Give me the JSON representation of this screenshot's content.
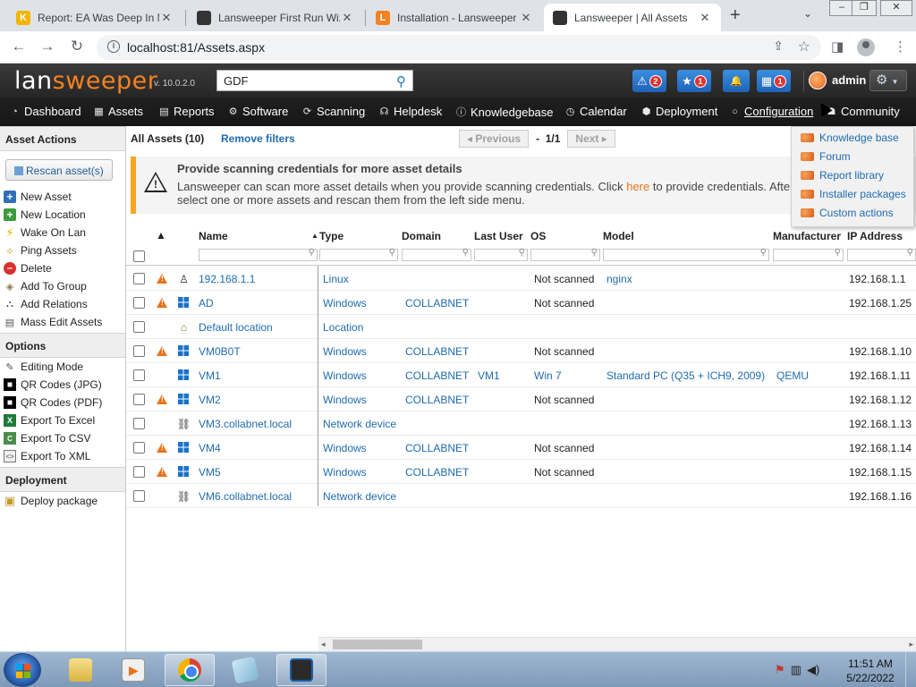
{
  "browser": {
    "tabs": [
      {
        "title": "Report: EA Was Deep In M",
        "favicon_color": "#f4b400",
        "favicon_glyph": "K",
        "active": false
      },
      {
        "title": "Lansweeper First Run Wiz",
        "favicon_color": "#333333",
        "favicon_glyph": "",
        "active": false
      },
      {
        "title": "Installation - Lansweeper",
        "favicon_color": "#f58220",
        "favicon_glyph": "L",
        "active": false
      },
      {
        "title": "Lansweeper | All Assets",
        "favicon_color": "#333333",
        "favicon_glyph": "",
        "active": true
      }
    ],
    "new_tab": "+",
    "tab_menu": "⌄",
    "window_controls": [
      "–",
      "❐",
      "✕"
    ],
    "url": "localhost:81/Assets.aspx",
    "icons": {
      "back": "back-icon",
      "forward": "forward-icon",
      "reload": "reload-icon",
      "info": "info-icon",
      "share": "share-icon",
      "star": "bookmark-star-icon",
      "sidepanel": "side-panel-icon",
      "profile": "profile-icon",
      "menu": "kebab-menu-icon"
    }
  },
  "header": {
    "logo_part1": "lan",
    "logo_part2": "sweeper",
    "version": "v. 10.0.2.0",
    "search_value": "GDF",
    "buttons": [
      {
        "name": "alerts-button",
        "icon": "⚠",
        "count": "2"
      },
      {
        "name": "favorites-button",
        "icon": "★",
        "count": "1"
      },
      {
        "name": "notifications-button",
        "icon": "🔔",
        "count": ""
      },
      {
        "name": "calendar-button",
        "icon": "▦",
        "count": "1"
      }
    ],
    "user": "admin",
    "settings_icon": "⚙",
    "brand_orange": "#f58220"
  },
  "nav": [
    {
      "label": "Dashboard",
      "icon": "dashboard-icon",
      "glyph": "◔"
    },
    {
      "label": "Assets",
      "icon": "assets-icon",
      "glyph": "▦"
    },
    {
      "label": "Reports",
      "icon": "reports-icon",
      "glyph": "▤"
    },
    {
      "label": "Software",
      "icon": "software-icon",
      "glyph": "⚙"
    },
    {
      "label": "Scanning",
      "icon": "scanning-icon",
      "glyph": "⟳"
    },
    {
      "label": "Helpdesk",
      "icon": "helpdesk-icon",
      "glyph": "☊"
    },
    {
      "label": "Knowledgebase",
      "icon": "knowledgebase-icon",
      "glyph": "ⓘ"
    },
    {
      "label": "Calendar",
      "icon": "calendar-icon",
      "glyph": "◷"
    },
    {
      "label": "Deployment",
      "icon": "deployment-icon",
      "glyph": "⬢"
    },
    {
      "label": "Configuration",
      "icon": "configuration-icon",
      "glyph": "○"
    },
    {
      "label": "Community",
      "icon": "community-icon",
      "glyph": "☗"
    }
  ],
  "sidebar": {
    "asset_actions_title": "Asset Actions",
    "rescan_label": "Rescan asset(s)",
    "actions": [
      {
        "label": "New Asset",
        "icon": "new-asset-icon"
      },
      {
        "label": "New Location",
        "icon": "new-location-icon"
      },
      {
        "label": "Wake On Lan",
        "icon": "wake-on-lan-icon"
      },
      {
        "label": "Ping Assets",
        "icon": "ping-icon"
      },
      {
        "label": "Delete",
        "icon": "delete-icon"
      },
      {
        "label": "Add To Group",
        "icon": "add-to-group-icon"
      },
      {
        "label": "Add Relations",
        "icon": "relations-icon"
      },
      {
        "label": "Mass Edit Assets",
        "icon": "mass-edit-icon"
      }
    ],
    "options_title": "Options",
    "options": [
      {
        "label": "Editing Mode",
        "icon": "editing-mode-icon"
      },
      {
        "label": "QR Codes (JPG)",
        "icon": "qr-code-icon"
      },
      {
        "label": "QR Codes (PDF)",
        "icon": "qr-code-icon"
      },
      {
        "label": "Export To Excel",
        "icon": "excel-icon"
      },
      {
        "label": "Export To CSV",
        "icon": "csv-icon"
      },
      {
        "label": "Export To XML",
        "icon": "xml-icon"
      }
    ],
    "deployment_title": "Deployment",
    "deployment": [
      {
        "label": "Deploy package",
        "icon": "package-icon"
      }
    ]
  },
  "main": {
    "asset_count": "All Assets (10)",
    "remove_filters": "Remove filters",
    "pager": {
      "previous": "Previous",
      "page": "1/1",
      "next": "Next",
      "sep": "-"
    },
    "notice": {
      "title": "Provide scanning credentials for more asset details",
      "body_before": "Lansweeper can scan more asset details when you provide scanning credentials. Click ",
      "link": "here",
      "body_after": " to provide credentials. After th",
      "body_line2": "select one or more assets and rescan them from the left side menu."
    },
    "columns": [
      "Name",
      "Type",
      "Domain",
      "Last User",
      "OS",
      "Model",
      "Manufacturer",
      "IP Address"
    ],
    "sort_indicator": "▲",
    "rows": [
      {
        "warn": true,
        "type_icon": "linux",
        "name": "192.168.1.1",
        "type": "Linux",
        "domain": "",
        "last_user": "",
        "os": "Not scanned",
        "os_link": false,
        "model": "nginx",
        "manufacturer": "",
        "ip": "192.168.1.1"
      },
      {
        "warn": true,
        "type_icon": "windows",
        "name": "AD",
        "type": "Windows",
        "domain": "COLLABNET",
        "last_user": "",
        "os": "Not scanned",
        "os_link": false,
        "model": "",
        "manufacturer": "",
        "ip": "192.168.1.25"
      },
      {
        "warn": false,
        "type_icon": "location",
        "name": "Default location",
        "type": "Location",
        "domain": "",
        "last_user": "",
        "os": "",
        "os_link": false,
        "model": "",
        "manufacturer": "",
        "ip": ""
      },
      {
        "warn": true,
        "type_icon": "windows",
        "name": "VM0B0T",
        "type": "Windows",
        "domain": "COLLABNET",
        "last_user": "",
        "os": "Not scanned",
        "os_link": false,
        "model": "",
        "manufacturer": "",
        "ip": "192.168.1.10"
      },
      {
        "warn": false,
        "type_icon": "windows",
        "name": "VM1",
        "type": "Windows",
        "domain": "COLLABNET",
        "last_user": "VM1",
        "os": "Win 7",
        "os_link": true,
        "model": "Standard PC (Q35 + ICH9, 2009)",
        "manufacturer": "QEMU",
        "ip": "192.168.1.11"
      },
      {
        "warn": true,
        "type_icon": "windows",
        "name": "VM2",
        "type": "Windows",
        "domain": "COLLABNET",
        "last_user": "",
        "os": "Not scanned",
        "os_link": false,
        "model": "",
        "manufacturer": "",
        "ip": "192.168.1.12"
      },
      {
        "warn": false,
        "type_icon": "network",
        "name": "VM3.collabnet.local",
        "type": "Network device",
        "domain": "",
        "last_user": "",
        "os": "",
        "os_link": false,
        "model": "",
        "manufacturer": "",
        "ip": "192.168.1.13"
      },
      {
        "warn": true,
        "type_icon": "windows",
        "name": "VM4",
        "type": "Windows",
        "domain": "COLLABNET",
        "last_user": "",
        "os": "Not scanned",
        "os_link": false,
        "model": "",
        "manufacturer": "",
        "ip": "192.168.1.14"
      },
      {
        "warn": true,
        "type_icon": "windows",
        "name": "VM5",
        "type": "Windows",
        "domain": "COLLABNET",
        "last_user": "",
        "os": "Not scanned",
        "os_link": false,
        "model": "",
        "manufacturer": "",
        "ip": "192.168.1.15"
      },
      {
        "warn": false,
        "type_icon": "network",
        "name": "VM6.collabnet.local",
        "type": "Network device",
        "domain": "",
        "last_user": "",
        "os": "",
        "os_link": false,
        "model": "",
        "manufacturer": "",
        "ip": "192.168.1.16"
      }
    ]
  },
  "config_menu": [
    {
      "label": "Knowledge base"
    },
    {
      "label": "Forum"
    },
    {
      "label": "Report library"
    },
    {
      "label": "Installer packages"
    },
    {
      "label": "Custom actions"
    }
  ],
  "taskbar": {
    "apps": [
      "explorer-icon",
      "media-player-icon",
      "chrome-icon",
      "notepad-icon",
      "lansweeper-app-icon"
    ],
    "time": "11:51 AM",
    "date": "5/22/2022"
  }
}
